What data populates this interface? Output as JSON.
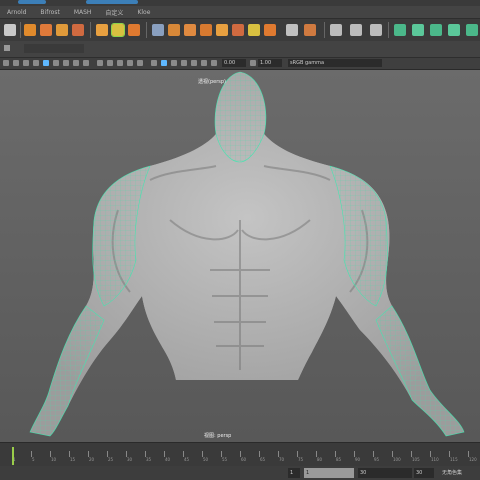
{
  "menubar": {
    "items": [
      "Arnold",
      "Bifrost",
      "MASH",
      "自定义",
      "Kloe"
    ]
  },
  "status": {
    "layer_field": "",
    "search_placeholder": ""
  },
  "panel_toolbar": {
    "value_left": "0.00",
    "value_right": "1.00",
    "color_space": "sRGB gamma"
  },
  "viewport": {
    "top_label": "透视(persp)",
    "bottom_label": "视图: persp"
  },
  "timeline": {
    "ticks": [
      "1",
      "5",
      "10",
      "15",
      "20",
      "25",
      "30",
      "35",
      "40",
      "45",
      "50",
      "55",
      "60",
      "65",
      "70",
      "75",
      "80",
      "85",
      "90",
      "95",
      "100",
      "105",
      "110",
      "115",
      "120"
    ]
  },
  "range": {
    "start": "1",
    "min_start": "1",
    "end": "30",
    "max_end": "30",
    "charset": "无角色集"
  },
  "colors": {
    "wire": "#3fe8b0",
    "skin": "#b8b8b8",
    "accent": "#3c7fb8"
  }
}
